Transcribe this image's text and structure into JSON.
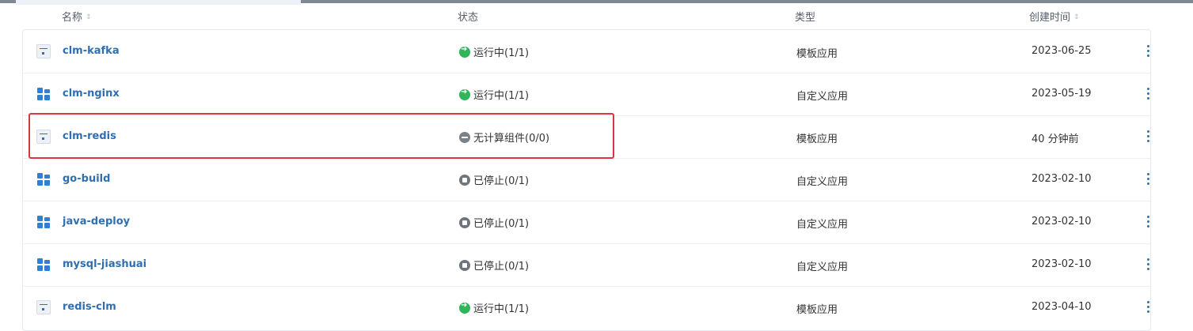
{
  "table": {
    "headers": {
      "name": "名称",
      "status": "状态",
      "type": "类型",
      "created": "创建时间"
    },
    "rows": [
      {
        "icon": "template-app-icon",
        "name": "clm-kafka",
        "status": "运行中(1/1)",
        "status_kind": "running",
        "type": "模板应用",
        "created": "2023-06-25"
      },
      {
        "icon": "custom-app-icon",
        "name": "clm-nginx",
        "status": "运行中(1/1)",
        "status_kind": "running",
        "type": "自定义应用",
        "created": "2023-05-19"
      },
      {
        "icon": "template-app-icon",
        "name": "clm-redis",
        "status": "无计算组件(0/0)",
        "status_kind": "none",
        "type": "模板应用",
        "created": "40 分钟前"
      },
      {
        "icon": "custom-app-icon",
        "name": "go-build",
        "status": "已停止(0/1)",
        "status_kind": "stopped",
        "type": "自定义应用",
        "created": "2023-02-10"
      },
      {
        "icon": "custom-app-icon",
        "name": "java-deploy",
        "status": "已停止(0/1)",
        "status_kind": "stopped",
        "type": "自定义应用",
        "created": "2023-02-10"
      },
      {
        "icon": "custom-app-icon",
        "name": "mysql-jiashuai",
        "status": "已停止(0/1)",
        "status_kind": "stopped",
        "type": "自定义应用",
        "created": "2023-02-10"
      },
      {
        "icon": "template-app-icon",
        "name": "redis-clm",
        "status": "运行中(1/1)",
        "status_kind": "running",
        "type": "模板应用",
        "created": "2023-04-10"
      }
    ]
  },
  "colors": {
    "link": "#2f6fb1",
    "running": "#2fb55a",
    "stopped": "#6f757e",
    "highlight": "#d9363e"
  }
}
